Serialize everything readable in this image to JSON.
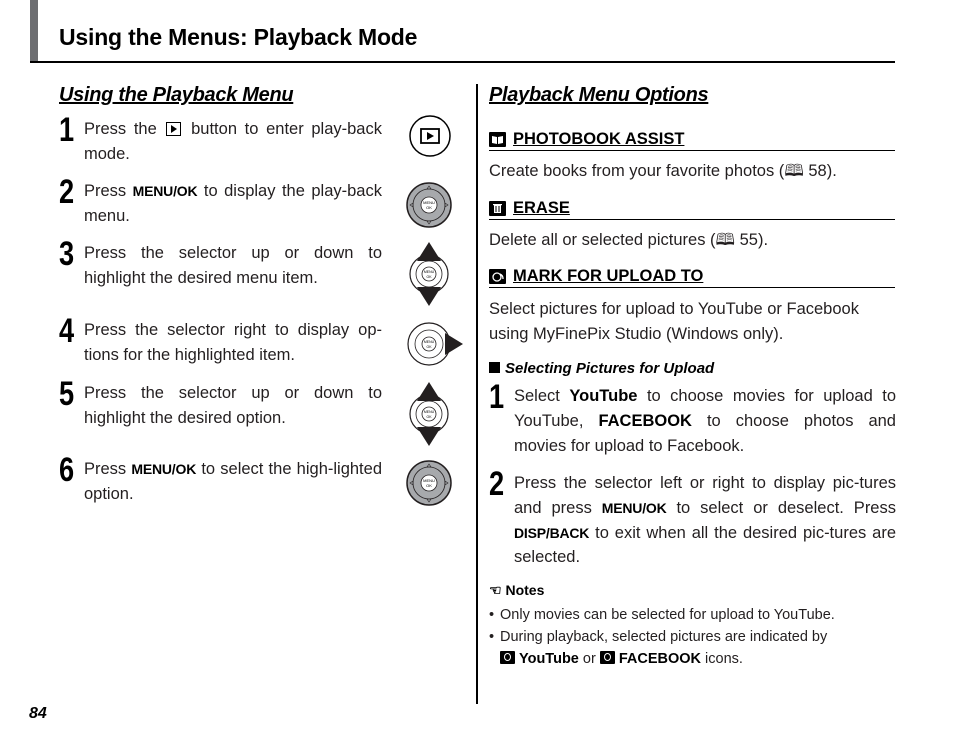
{
  "header": {
    "title": "Using the Menus: Playback Mode"
  },
  "left": {
    "title": "Using the Playback Menu",
    "steps": [
      {
        "num": "1",
        "pre": "Press the",
        "post": "button to enter play-back mode.",
        "icon": "playback-button-icon"
      },
      {
        "num": "2",
        "pre": "Press",
        "kw": "MENU/OK",
        "post": "to display the play-back menu.",
        "icon": "selector-menu-ok-pressed-icon"
      },
      {
        "num": "3",
        "text": "Press the selector up or down to highlight the desired menu item.",
        "icon": "selector-up-down-icon"
      },
      {
        "num": "4",
        "text": "Press the selector right to display op-tions for the highlighted item.",
        "icon": "selector-right-icon"
      },
      {
        "num": "5",
        "text": "Press the selector up or down to highlight the desired option.",
        "icon": "selector-up-down-icon"
      },
      {
        "num": "6",
        "pre": "Press",
        "kw": "MENU/OK",
        "post": "to select the high-lighted option.",
        "icon": "selector-menu-ok-pressed-icon"
      }
    ],
    "selector_center_label": "MENU OK"
  },
  "right": {
    "title": "Playback Menu Options",
    "options": [
      {
        "icon": "photobook-icon",
        "label": "PHOTOBOOK ASSIST",
        "desc_pre": "Create books from your favorite photos (",
        "ref_icon": "page-reference-icon",
        "ref": "58",
        "desc_post": ")."
      },
      {
        "icon": "erase-trash-icon",
        "label": "ERASE",
        "desc_pre": "Delete all or selected pictures (",
        "ref_icon": "page-reference-icon",
        "ref": "55",
        "desc_post": ")."
      },
      {
        "icon": "upload-globe-icon",
        "label": "MARK FOR UPLOAD TO",
        "desc": "Select pictures for upload to YouTube or Facebook using MyFinePix Studio (Windows only)."
      }
    ],
    "subsection": {
      "title": "Selecting Pictures for Upload",
      "steps": [
        {
          "num": "1",
          "p1": "Select",
          "b1": "YouTube",
          "p2": "to choose movies for upload to YouTube,",
          "b2": "FACEBOOK",
          "p3": "to choose photos and movies for upload to Facebook."
        },
        {
          "num": "2",
          "p1": "Press the selector left or right to display pic-tures and press",
          "k1": "MENU/OK",
          "p2": "to select or deselect. Press",
          "k2": "DISP/BACK",
          "p3": "to exit when all the desired pic-tures are selected."
        }
      ]
    },
    "notes": {
      "title": "Notes",
      "items": [
        {
          "text": "Only movies can be selected for upload to YouTube."
        },
        {
          "pre": "During playback, selected pictures are indicated by",
          "b1": "YouTube",
          "mid": "or",
          "b2": "FACEBOOK",
          "post": "icons."
        }
      ]
    }
  },
  "footer": {
    "page_number": "84"
  }
}
